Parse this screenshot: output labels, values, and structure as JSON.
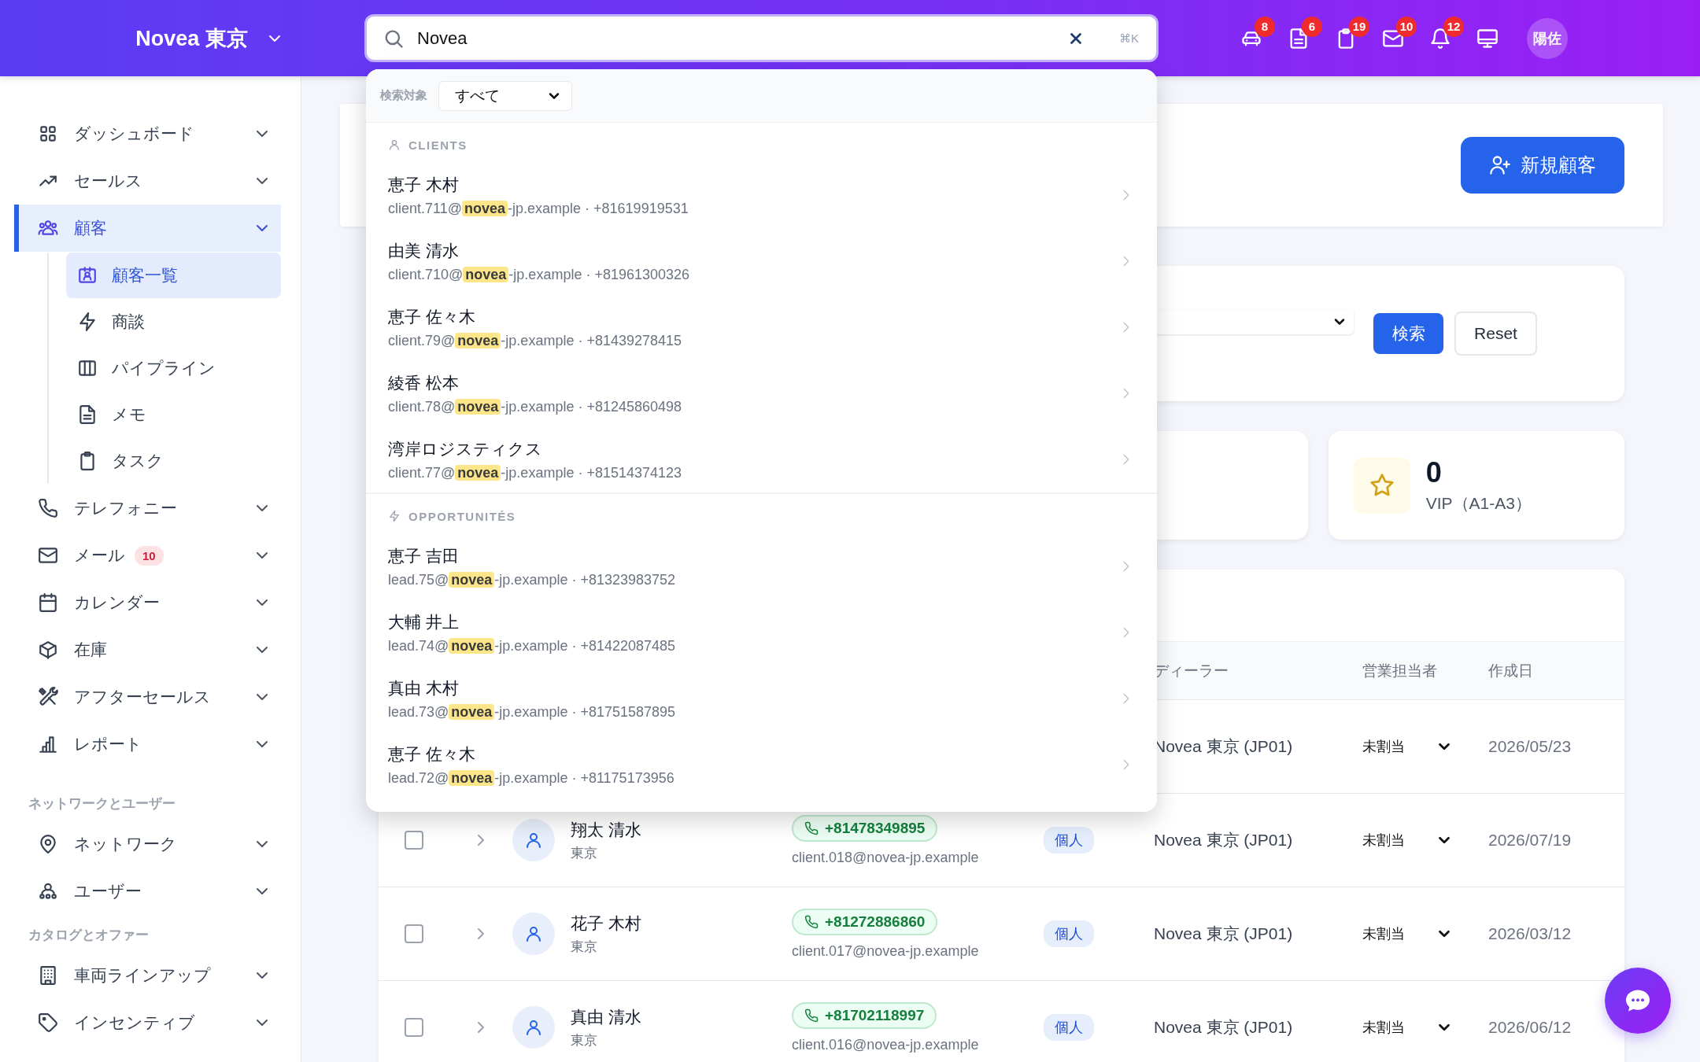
{
  "header": {
    "brand": "Novea 東京",
    "avatar": "陽佐",
    "icon_badges": [
      "8",
      "6",
      "19",
      "10",
      "12"
    ]
  },
  "search": {
    "value": "Novea",
    "shortcut": "⌘K"
  },
  "search_results": {
    "scope_label": "検索対象",
    "scope_value": "すべて",
    "groups": [
      {
        "title": "CLIENTS",
        "results": [
          {
            "name": "恵子 木村",
            "before": "client.711@",
            "match": "novea",
            "after": "-jp.example · +81619919531"
          },
          {
            "name": "由美 清水",
            "before": "client.710@",
            "match": "novea",
            "after": "-jp.example · +81961300326"
          },
          {
            "name": "恵子 佐々木",
            "before": "client.79@",
            "match": "novea",
            "after": "-jp.example · +81439278415"
          },
          {
            "name": "綾香 松本",
            "before": "client.78@",
            "match": "novea",
            "after": "-jp.example · +81245860498"
          },
          {
            "name": "湾岸ロジスティクス",
            "before": "client.77@",
            "match": "novea",
            "after": "-jp.example · +81514374123"
          }
        ]
      },
      {
        "title": "OPPORTUNITÉS",
        "results": [
          {
            "name": "恵子 吉田",
            "before": "lead.75@",
            "match": "novea",
            "after": "-jp.example · +81323983752"
          },
          {
            "name": "大輔 井上",
            "before": "lead.74@",
            "match": "novea",
            "after": "-jp.example · +81422087485"
          },
          {
            "name": "真由 木村",
            "before": "lead.73@",
            "match": "novea",
            "after": "-jp.example · +81751587895"
          },
          {
            "name": "恵子 佐々木",
            "before": "lead.72@",
            "match": "novea",
            "after": "-jp.example · +81175173956"
          }
        ]
      }
    ]
  },
  "sidebar": {
    "sections": [
      {
        "items": [
          {
            "label": "ダッシュボード",
            "selected": false
          },
          {
            "label": "セールス",
            "selected": false
          },
          {
            "label": "顧客",
            "selected": true,
            "children": [
              {
                "label": "顧客一覧",
                "selected": true
              },
              {
                "label": "商談",
                "selected": false
              },
              {
                "label": "パイプライン",
                "selected": false
              },
              {
                "label": "メモ",
                "selected": false
              },
              {
                "label": "タスク",
                "selected": false
              }
            ]
          },
          {
            "label": "テレフォニー",
            "selected": false
          },
          {
            "label": "メール",
            "selected": false,
            "badge": "10"
          },
          {
            "label": "カレンダー",
            "selected": false
          },
          {
            "label": "在庫",
            "selected": false
          },
          {
            "label": "アフターセールス",
            "selected": false
          },
          {
            "label": "レポート",
            "selected": false
          }
        ]
      },
      {
        "title": "ネットワークとユーザー",
        "items": [
          {
            "label": "ネットワーク",
            "selected": false
          },
          {
            "label": "ユーザー",
            "selected": false
          }
        ]
      },
      {
        "title": "カタログとオファー",
        "items": [
          {
            "label": "車両ラインアップ",
            "selected": false
          },
          {
            "label": "インセンティブ",
            "selected": false
          }
        ]
      }
    ]
  },
  "page_header": {
    "new_button": "新規顧客"
  },
  "filters": {
    "search_button": "検索",
    "reset_button": "Reset"
  },
  "stats": [
    {
      "value": "0",
      "label": "VIP（A1-A3）"
    }
  ],
  "table": {
    "columns": [
      "ディーラー",
      "営業担当者",
      "作成日"
    ],
    "rows": [
      {
        "dealer": "Novea 東京 (JP01)",
        "assignee": "未割当",
        "created": "2026/05/23"
      },
      {
        "checked": false,
        "name": "翔太 清水",
        "city": "東京",
        "phone": "+81478349895",
        "email": "client.018@novea-jp.example",
        "type": "個人",
        "dealer": "Novea 東京 (JP01)",
        "assignee": "未割当",
        "created": "2026/07/19"
      },
      {
        "checked": false,
        "name": "花子 木村",
        "city": "東京",
        "phone": "+81272886860",
        "email": "client.017@novea-jp.example",
        "type": "個人",
        "dealer": "Novea 東京 (JP01)",
        "assignee": "未割当",
        "created": "2026/03/12"
      },
      {
        "checked": false,
        "name": "真由 清水",
        "city": "東京",
        "phone": "+81702118997",
        "email": "client.016@novea-jp.example",
        "type": "個人",
        "dealer": "Novea 東京 (JP01)",
        "assignee": "未割当",
        "created": "2026/06/12"
      }
    ]
  }
}
